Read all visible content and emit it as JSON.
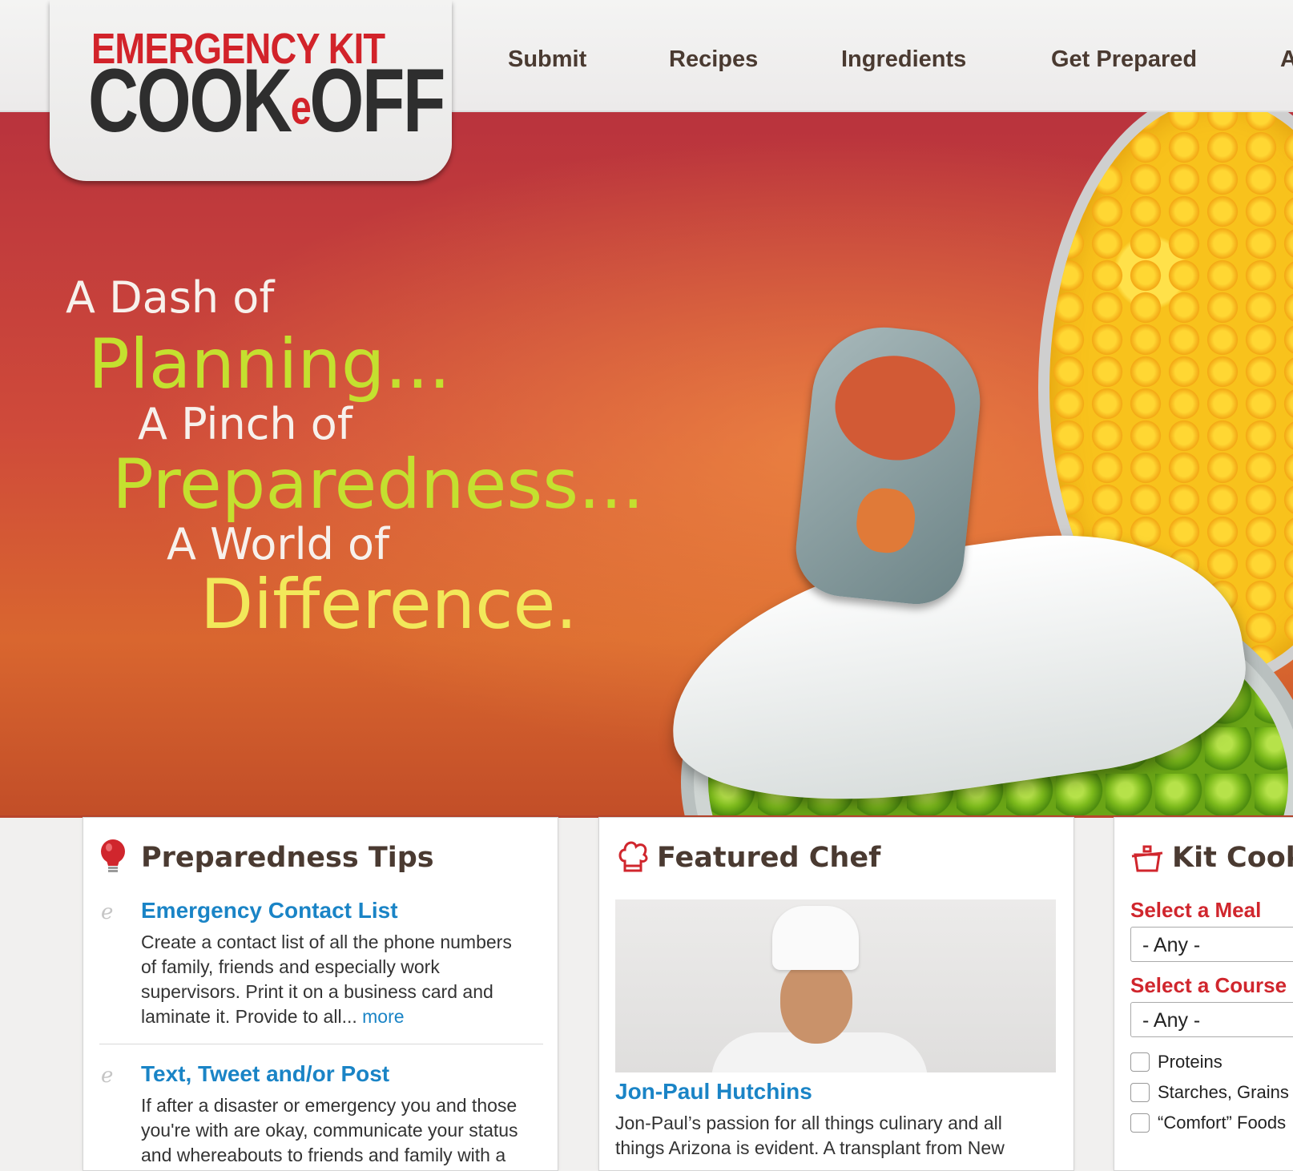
{
  "logo": {
    "top_text": "EMERGENCY KIT",
    "main_left": "COOK",
    "main_mid": "e",
    "main_right": "OFF"
  },
  "nav": {
    "items": [
      "Submit",
      "Recipes",
      "Ingredients",
      "Get Prepared",
      "A"
    ]
  },
  "hero": {
    "line1": "A Dash of",
    "line2": "Planning...",
    "line3": "A Pinch of",
    "line4": "Preparedness...",
    "line5": "A World of",
    "line6": "Difference."
  },
  "tips": {
    "title": "Preparedness Tips",
    "items": [
      {
        "title": "Emergency Contact List",
        "body_lines": [
          "Create a contact list of all the phone numbers",
          "of family, friends and especially work",
          "supervisors. Print it on a business card and"
        ],
        "last_line": "laminate it. Provide to all...",
        "more": "more"
      },
      {
        "title": "Text, Tweet and/or Post",
        "body_lines": [
          "If after a disaster or emergency you and those",
          "you're with are okay, communicate your status",
          "and whereabouts to friends and family with a"
        ]
      }
    ]
  },
  "featured_chef": {
    "title": "Featured Chef",
    "name": "Jon-Paul Hutchins",
    "body_lines": [
      "Jon-Paul’s passion for all things culinary and all",
      "things Arizona is evident. A transplant from New"
    ]
  },
  "kit_cook": {
    "title": "Kit Cook",
    "meal_label": "Select a Meal",
    "meal_value": "- Any -",
    "course_label": "Select a Course",
    "course_value": "- Any -",
    "checkboxes": [
      "Proteins",
      "Starches, Grains",
      "“Comfort” Foods"
    ]
  },
  "colors": {
    "brand_red": "#d2232a",
    "link_blue": "#1a84c6",
    "nav_brown": "#4a3a31",
    "hero_green": "#c4e02f"
  }
}
